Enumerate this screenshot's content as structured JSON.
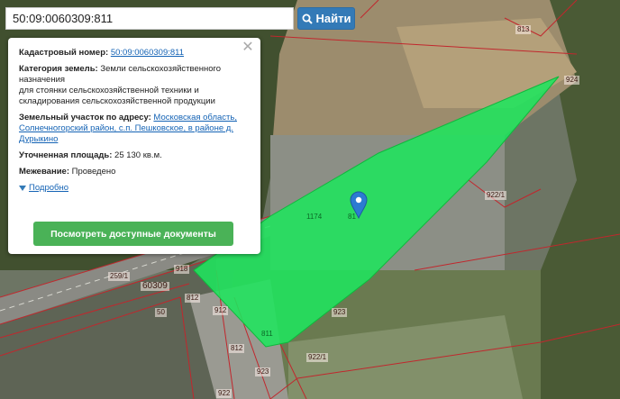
{
  "search": {
    "value": "50:09:0060309:811",
    "button_label": "Найти"
  },
  "popup": {
    "cadastral_label": "Кадастровый номер:",
    "cadastral_value": "50:09:0060309:811",
    "category_label": "Категория земель:",
    "category_value": "Земли сельскохозяйственного назначения",
    "purpose_line1": "для стоянки сельскохозяйственной техники и",
    "purpose_line2": "складирования сельскохозяйственной продукции",
    "address_label": "Земельный участок по адресу:",
    "address_value": "Московская область, Солнечногорский район, с.п. Пешковское, в районе д. Дурыкино",
    "area_label": "Уточненная площадь:",
    "area_value": "25 130 кв.м.",
    "survey_label": "Межевание:",
    "survey_value": "Проведено",
    "details_link": "Подробно",
    "docs_button": "Посмотреть доступные документы"
  },
  "map": {
    "parcel_color": "#1fe55d",
    "boundary_color": "#c1272d",
    "labels": [
      "813",
      "924",
      "922/1",
      "1174",
      "81",
      "259/1",
      "918",
      "60309",
      "812",
      "50",
      "912",
      "923",
      "811",
      "812",
      "923",
      "922/1",
      "922"
    ]
  }
}
